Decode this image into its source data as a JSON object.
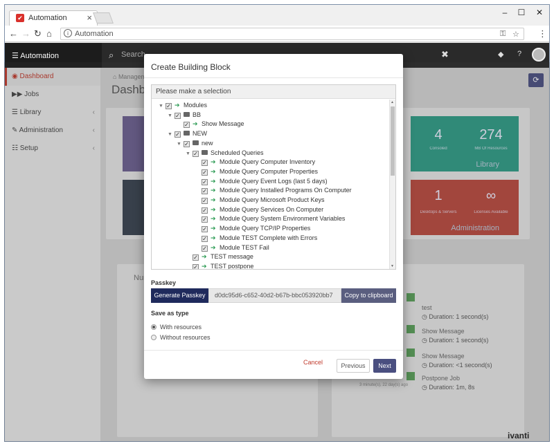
{
  "browser": {
    "tab_title": "Automation",
    "tab_close": "×",
    "address": "Automation",
    "win_min": "–",
    "win_max": "☐",
    "win_close": "✕"
  },
  "navbar": {
    "brand": "☰ Automation",
    "search_placeholder": "Search",
    "clear": "✖"
  },
  "sidebar": {
    "items": [
      {
        "label": "Dashboard"
      },
      {
        "label": "Jobs"
      },
      {
        "label": "Library"
      },
      {
        "label": "Administration"
      },
      {
        "label": "Setup"
      }
    ]
  },
  "content": {
    "breadcrumb": "Managem",
    "title": "Dashbo",
    "tiles": [
      {
        "number": "4",
        "label": "Consoled",
        "color": "#2e9c86"
      },
      {
        "number": "274",
        "label": "MB Of Resources",
        "color": "#2e9c86"
      },
      {
        "number": "1",
        "label": "Desktops & Servers",
        "color": "#b9483e"
      },
      {
        "number": "∞",
        "label": "Licenses Available",
        "color": "#b9483e"
      }
    ],
    "library_footer": "Library",
    "admin_footer": "Administration",
    "num_label": "Num",
    "jobs": [
      {
        "title": "test",
        "duration": "Duration: 1 second(s)"
      },
      {
        "title": "Show Message",
        "duration": "Duration: 1 second(s)"
      },
      {
        "title": "Show Message",
        "duration": "Duration: <1 second(s)"
      },
      {
        "title": "Postpone Job",
        "duration": "Duration: 1m, 8s"
      }
    ],
    "last_job_meta": "3 minute(s), 22 day(s) ago",
    "footer_logo": "ivanti"
  },
  "modal": {
    "title": "Create Building Block",
    "tree_header": "Please make a selection",
    "tree": [
      {
        "label": "Modules",
        "level": 0,
        "caret": true,
        "type": "arrow"
      },
      {
        "label": "BB",
        "level": 1,
        "caret": true,
        "type": "folder"
      },
      {
        "label": "Show Message",
        "level": 2,
        "caret": false,
        "type": "arrow"
      },
      {
        "label": "NEW",
        "level": 1,
        "caret": true,
        "type": "folder"
      },
      {
        "label": "new",
        "level": 2,
        "caret": true,
        "type": "folder"
      },
      {
        "label": "Scheduled Queries",
        "level": 3,
        "caret": true,
        "type": "folder"
      },
      {
        "label": "Module Query Computer Inventory",
        "level": 4,
        "caret": false,
        "type": "arrow"
      },
      {
        "label": "Module Query Computer Properties",
        "level": 4,
        "caret": false,
        "type": "arrow"
      },
      {
        "label": "Module Query Event Logs (last 5 days)",
        "level": 4,
        "caret": false,
        "type": "arrow"
      },
      {
        "label": "Module Query Installed Programs On Computer",
        "level": 4,
        "caret": false,
        "type": "arrow"
      },
      {
        "label": "Module Query Microsoft Product Keys",
        "level": 4,
        "caret": false,
        "type": "arrow"
      },
      {
        "label": "Module Query Services On Computer",
        "level": 4,
        "caret": false,
        "type": "arrow"
      },
      {
        "label": "Module Query System Environment Variables",
        "level": 4,
        "caret": false,
        "type": "arrow"
      },
      {
        "label": "Module Query TCP/IP Properties",
        "level": 4,
        "caret": false,
        "type": "arrow"
      },
      {
        "label": "Module TEST Complete with Errors",
        "level": 4,
        "caret": false,
        "type": "arrow"
      },
      {
        "label": "Module TEST Fail",
        "level": 4,
        "caret": false,
        "type": "arrow"
      },
      {
        "label": "TEST message",
        "level": 3,
        "caret": false,
        "type": "arrow"
      },
      {
        "label": "TEST postpone",
        "level": 3,
        "caret": false,
        "type": "arrow"
      }
    ],
    "passkey_label": "Passkey",
    "generate_label": "Generate Passkey",
    "passkey_value": "d0dc95d6-c652-40d2-b67b-bbc053920bb7",
    "copy_label": "Copy to clipboard",
    "save_label": "Save as type",
    "option_with": "With resources",
    "option_without": "Without resources",
    "selected_option": "With resources",
    "cancel_label": "Cancel",
    "previous_label": "Previous",
    "next_label": "Next"
  }
}
